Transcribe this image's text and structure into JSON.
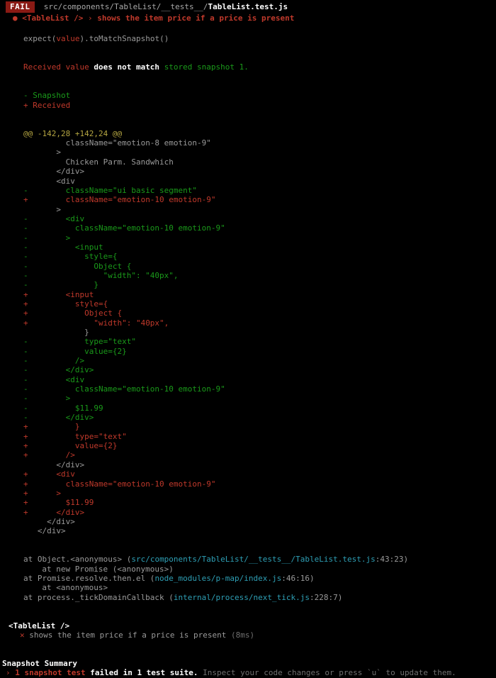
{
  "terminal": {
    "background": "#000000",
    "colors": {
      "removed": "#1a9a1a",
      "added": "#c0392b",
      "context": "#9a9a9a",
      "hunk": "#b5a642",
      "path": "#2e9fb5",
      "fail_badge_bg": "#8b1a14"
    }
  },
  "header": {
    "status_badge": "FAIL",
    "path_prefix": "src/components/TableList/__tests__/",
    "path_file": "TableList.test.js",
    "bullet": "●",
    "suite_name": "<TableList />",
    "separator": "›",
    "test_name": "shows the item price if a price is present"
  },
  "assertion": {
    "expect_prefix": "expect(",
    "expect_arg": "value",
    "expect_suffix": ").toMatchSnapshot()",
    "mismatch_received": "Received value",
    "mismatch_middle": " does not match ",
    "mismatch_stored": "stored snapshot 1.",
    "legend_snapshot": "- Snapshot",
    "legend_received": "+ Received",
    "hunk_header": "@@ -142,28 +142,24 @@"
  },
  "diff_lines": [
    {
      "marker": " ",
      "kind": "context",
      "text": "        className=\"emotion-8 emotion-9\""
    },
    {
      "marker": " ",
      "kind": "context",
      "text": "      >"
    },
    {
      "marker": " ",
      "kind": "context",
      "text": "        Chicken Parm. Sandwhich"
    },
    {
      "marker": " ",
      "kind": "context",
      "text": "      </div>"
    },
    {
      "marker": " ",
      "kind": "context",
      "text": "      <div"
    },
    {
      "marker": "-",
      "kind": "removed",
      "text": "        className=\"ui basic segment\""
    },
    {
      "marker": "+",
      "kind": "added",
      "text": "        className=\"emotion-10 emotion-9\""
    },
    {
      "marker": " ",
      "kind": "context",
      "text": "      >"
    },
    {
      "marker": "-",
      "kind": "removed",
      "text": "        <div"
    },
    {
      "marker": "-",
      "kind": "removed",
      "text": "          className=\"emotion-10 emotion-9\""
    },
    {
      "marker": "-",
      "kind": "removed",
      "text": "        >"
    },
    {
      "marker": "-",
      "kind": "removed",
      "text": "          <input"
    },
    {
      "marker": "-",
      "kind": "removed",
      "text": "            style={"
    },
    {
      "marker": "-",
      "kind": "removed",
      "text": "              Object {"
    },
    {
      "marker": "-",
      "kind": "removed",
      "text": "                \"width\": \"40px\","
    },
    {
      "marker": "-",
      "kind": "removed",
      "text": "              }"
    },
    {
      "marker": "+",
      "kind": "added",
      "text": "        <input"
    },
    {
      "marker": "+",
      "kind": "added",
      "text": "          style={"
    },
    {
      "marker": "+",
      "kind": "added",
      "text": "            Object {"
    },
    {
      "marker": "+",
      "kind": "added",
      "text": "              \"width\": \"40px\","
    },
    {
      "marker": " ",
      "kind": "context",
      "text": "            }"
    },
    {
      "marker": "-",
      "kind": "removed",
      "text": "            type=\"text\""
    },
    {
      "marker": "-",
      "kind": "removed",
      "text": "            value={2}"
    },
    {
      "marker": "-",
      "kind": "removed",
      "text": "          />"
    },
    {
      "marker": "-",
      "kind": "removed",
      "text": "        </div>"
    },
    {
      "marker": "-",
      "kind": "removed",
      "text": "        <div"
    },
    {
      "marker": "-",
      "kind": "removed",
      "text": "          className=\"emotion-10 emotion-9\""
    },
    {
      "marker": "-",
      "kind": "removed",
      "text": "        >"
    },
    {
      "marker": "-",
      "kind": "removed",
      "text": "          $11.99"
    },
    {
      "marker": "-",
      "kind": "removed",
      "text": "        </div>"
    },
    {
      "marker": "+",
      "kind": "added",
      "text": "          }"
    },
    {
      "marker": "+",
      "kind": "added",
      "text": "          type=\"text\""
    },
    {
      "marker": "+",
      "kind": "added",
      "text": "          value={2}"
    },
    {
      "marker": "+",
      "kind": "added",
      "text": "        />"
    },
    {
      "marker": " ",
      "kind": "context",
      "text": "      </div>"
    },
    {
      "marker": "+",
      "kind": "added",
      "text": "      <div"
    },
    {
      "marker": "+",
      "kind": "added",
      "text": "        className=\"emotion-10 emotion-9\""
    },
    {
      "marker": "+",
      "kind": "added",
      "text": "      >"
    },
    {
      "marker": "+",
      "kind": "added",
      "text": "        $11.99"
    },
    {
      "marker": "+",
      "kind": "added",
      "text": "      </div>"
    },
    {
      "marker": " ",
      "kind": "context",
      "text": "    </div>"
    },
    {
      "marker": " ",
      "kind": "context",
      "text": "  </div>"
    }
  ],
  "stack_trace": [
    {
      "indent": 6,
      "fn": "at Object.<anonymous> (",
      "path": "src/components/TableList/__tests__/TableList.test.js",
      "loc": ":43:23",
      "close": ")"
    },
    {
      "indent": 10,
      "fn": "at new Promise (<anonymous>)",
      "path": "",
      "loc": "",
      "close": ""
    },
    {
      "indent": 6,
      "fn": "at Promise.resolve.then.el (",
      "path": "node_modules/p-map/index.js",
      "loc": ":46:16",
      "close": ")"
    },
    {
      "indent": 10,
      "fn": "at <anonymous>",
      "path": "",
      "loc": "",
      "close": ""
    },
    {
      "indent": 6,
      "fn": "at process._tickDomainCallback (",
      "path": "internal/process/next_tick.js",
      "loc": ":228:7",
      "close": ")"
    }
  ],
  "results": {
    "suite_label": "<TableList />",
    "fail_glyph": "✕",
    "test_label": "shows the item price if a price is present",
    "duration": "(8ms)"
  },
  "summary": {
    "title": "Snapshot Summary",
    "arrow": "›",
    "count_text": "1 snapshot test",
    "failed_text": " failed in 1 test suite.",
    "hint_text": " Inspect your code changes or press `u` to update them."
  }
}
